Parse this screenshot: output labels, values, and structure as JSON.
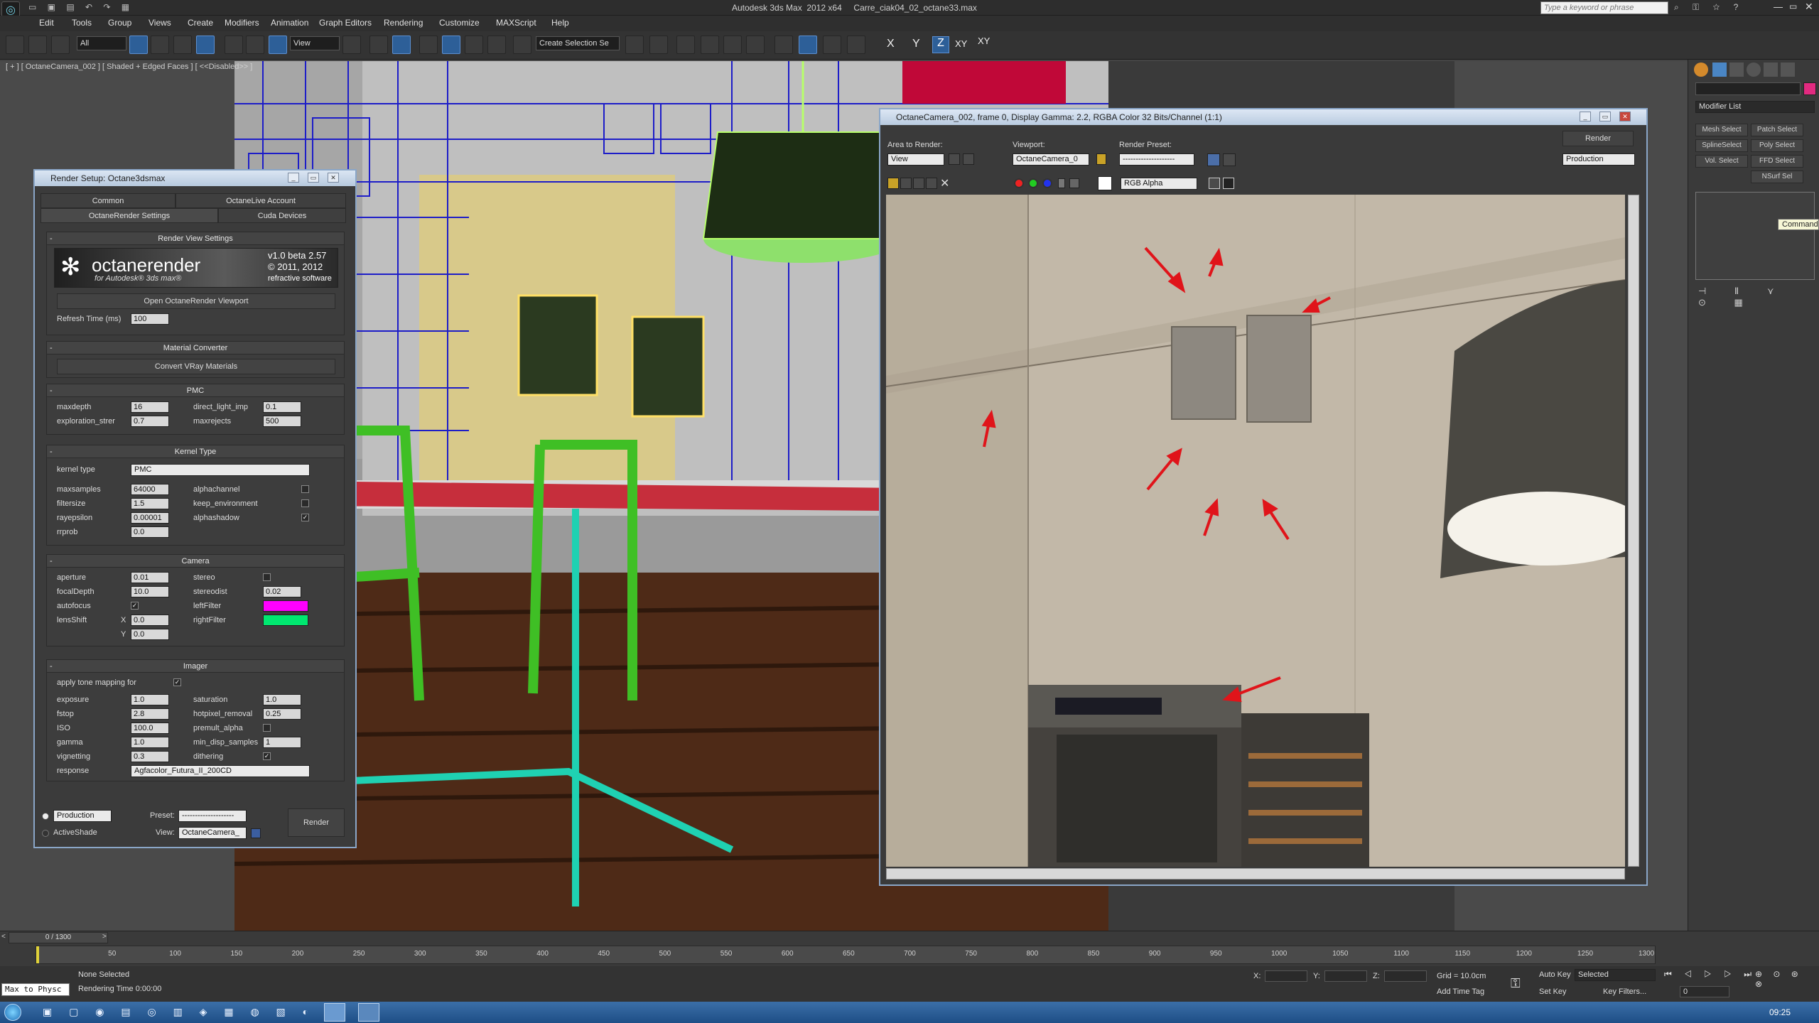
{
  "app": {
    "title": "Autodesk 3ds Max  2012 x64     Carre_ciak04_02_octane33.max",
    "search_placeholder": "Type a keyword or phrase"
  },
  "menu": [
    "Edit",
    "Tools",
    "Group",
    "Views",
    "Create",
    "Modifiers",
    "Animation",
    "Graph Editors",
    "Rendering",
    "Customize",
    "MAXScript",
    "Help"
  ],
  "toolbar": {
    "filter_select": "All",
    "ref_coord_select": "View",
    "named_selection": "Create Selection Se",
    "axis_labels": [
      "X",
      "Y",
      "Z",
      "XY",
      "XY"
    ]
  },
  "viewport": {
    "label": "[ + ] [ OctaneCamera_002 ] [ Shaded + Edged Faces ] [ <<Disabled>> ]"
  },
  "render_setup": {
    "title": "Render Setup: Octane3dsmax",
    "tabs": [
      "Common",
      "OctaneLive Account",
      "OctaneRender Settings",
      "Cuda Devices"
    ],
    "view_settings_header": "Render View Settings",
    "logo_text": "octanerender",
    "logo_sub": "for Autodesk® 3ds max®",
    "version": "v1.0 beta 2.57",
    "copyright": "© 2011, 2012",
    "company": "refractive software",
    "open_viewport_btn": "Open OctaneRender Viewport",
    "refresh_label": "Refresh Time (ms)",
    "refresh_value": "100",
    "material_header": "Material Converter",
    "convert_btn": "Convert VRay Materials",
    "pmc_header": "PMC",
    "pmc": {
      "maxdepth_label": "maxdepth",
      "maxdepth": "16",
      "direct_label": "direct_light_imp",
      "direct": "0.1",
      "exploration_label": "exploration_strer",
      "exploration": "0.7",
      "maxrejects_label": "maxrejects",
      "maxrejects": "500"
    },
    "kernel_header": "Kernel Type",
    "kernel": {
      "type_label": "kernel type",
      "type": "PMC",
      "maxsamples_label": "maxsamples",
      "maxsamples": "64000",
      "alphachannel_label": "alphachannel",
      "filtersize_label": "filtersize",
      "filtersize": "1.5",
      "keep_env_label": "keep_environment",
      "rayepsilon_label": "rayepsilon",
      "rayepsilon": "0.00001",
      "alphashadow_label": "alphashadow",
      "rrprob_label": "rrprob",
      "rrprob": "0.0"
    },
    "camera_header": "Camera",
    "camera": {
      "aperture_label": "aperture",
      "aperture": "0.01",
      "stereo_label": "stereo",
      "focal_label": "focalDepth",
      "focal": "10.0",
      "stereodist_label": "stereodist",
      "stereodist": "0.02",
      "autofocus_label": "autofocus",
      "leftfilter_label": "leftFilter",
      "lensshift_label": "lensShift",
      "lensshift_x_label": "X",
      "lensshift_x": "0.0",
      "rightfilter_label": "rightFilter",
      "lensshift_y_label": "Y",
      "lensshift_y": "0.0",
      "left_color": "#ff00ff",
      "right_color": "#00e870"
    },
    "imager_header": "Imager",
    "imager": {
      "tonemap_label": "apply tone mapping for",
      "exposure_label": "exposure",
      "exposure": "1.0",
      "saturation_label": "saturation",
      "saturation": "1.0",
      "fstop_label": "fstop",
      "fstop": "2.8",
      "hotpixel_label": "hotpixel_removal",
      "hotpixel": "0.25",
      "iso_label": "ISO",
      "iso": "100.0",
      "premult_label": "premult_alpha",
      "gamma_label": "gamma",
      "gamma": "1.0",
      "mindisp_label": "min_disp_samples",
      "mindisp": "1",
      "vignetting_label": "vignetting",
      "vignetting": "0.3",
      "dithering_label": "dithering",
      "response_label": "response",
      "response": "Agfacolor_Futura_II_200CD"
    },
    "footer": {
      "production": "Production",
      "activeshade": "ActiveShade",
      "preset_label": "Preset:",
      "preset_value": "--------------------",
      "view_label": "View:",
      "view_value": "OctaneCamera_",
      "render_btn": "Render"
    }
  },
  "frame_buffer": {
    "title": "OctaneCamera_002, frame 0, Display Gamma: 2.2, RGBA Color 32 Bits/Channel (1:1)",
    "area_label": "Area to Render:",
    "area_value": "View",
    "viewport_label": "Viewport:",
    "viewport_value": "OctaneCamera_0",
    "preset_label": "Render Preset:",
    "preset_value": "--------------------",
    "render_btn": "Render",
    "production_value": "Production",
    "channel_value": "RGB Alpha"
  },
  "command_panel": {
    "modifier_list": "Modifier List",
    "buttons": [
      "Mesh Select",
      "Patch Select",
      "SplineSelect",
      "Poly Select",
      "Vol. Select",
      "FFD Select",
      "NSurf Sel"
    ],
    "tooltip": "Command Panel"
  },
  "timeline": {
    "frame_readout": "0 / 1300",
    "ticks": [
      "50",
      "100",
      "150",
      "200",
      "250",
      "300",
      "350",
      "400",
      "450",
      "500",
      "550",
      "600",
      "650",
      "700",
      "750",
      "800",
      "850",
      "900",
      "950",
      "1000",
      "1050",
      "1100",
      "1150",
      "1200",
      "1250",
      "1300"
    ]
  },
  "status": {
    "script_listener": "Max to Physc",
    "selection": "None Selected",
    "render_time": "Rendering Time  0:00:00",
    "x_label": "X:",
    "y_label": "Y:",
    "z_label": "Z:",
    "grid": "Grid = 10.0cm",
    "add_time_tag": "Add Time Tag",
    "auto_key": "Auto Key",
    "selected": "Selected",
    "set_key": "Set Key",
    "key_filters": "Key Filters...",
    "frame_value": "0"
  },
  "taskbar": {
    "clock": "09:25"
  }
}
